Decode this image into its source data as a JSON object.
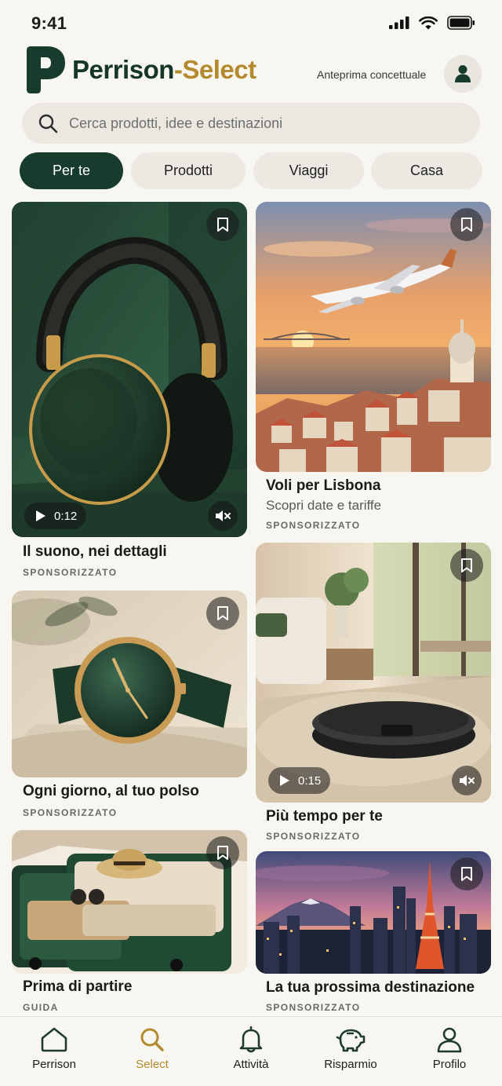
{
  "status": {
    "time": "9:41"
  },
  "header": {
    "brand_part1": "Perrison",
    "brand_part2": "-Select",
    "preview_label": "Anteprima concettuale"
  },
  "search": {
    "placeholder": "Cerca prodotti, idee e destinazioni"
  },
  "tabs": [
    {
      "label": "Per te",
      "active": true
    },
    {
      "label": "Prodotti",
      "active": false
    },
    {
      "label": "Viaggi",
      "active": false
    },
    {
      "label": "Casa",
      "active": false
    }
  ],
  "cards": [
    {
      "title": "Il suono, nei dettagli",
      "meta": "SPONSORIZZATO",
      "duration": "0:12",
      "image": "headphones"
    },
    {
      "title": "Voli per Lisbona",
      "subtitle": "Scopri date e tariffe",
      "meta": "SPONSORIZZATO",
      "image": "airplane-lisbon"
    },
    {
      "title": "Ogni giorno, al tuo polso",
      "meta": "SPONSORIZZATO",
      "image": "wristwatch"
    },
    {
      "title": "Più tempo per te",
      "meta": "SPONSORIZZATO",
      "duration": "0:15",
      "image": "robot-vacuum"
    },
    {
      "title": "Prima di partire",
      "meta": "GUIDA",
      "image": "suitcase"
    },
    {
      "title": "La tua prossima destinazione",
      "meta": "SPONSORIZZATO",
      "image": "tokyo-skyline"
    }
  ],
  "nav": [
    {
      "label": "Perrison",
      "icon": "home-icon",
      "active": false
    },
    {
      "label": "Select",
      "icon": "search-icon",
      "active": true
    },
    {
      "label": "Attività",
      "icon": "bell-icon",
      "active": false
    },
    {
      "label": "Risparmio",
      "icon": "piggy-bank-icon",
      "active": false
    },
    {
      "label": "Profilo",
      "icon": "user-icon",
      "active": false
    }
  ],
  "colors": {
    "brand_green": "#173b2c",
    "brand_gold": "#b48a2e",
    "background": "#f7f6f1"
  }
}
